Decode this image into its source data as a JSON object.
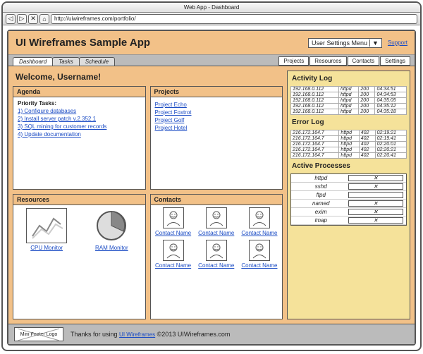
{
  "browser": {
    "title": "Web App - Dashboard",
    "url": "http://uiwireframes.com/portfolio/"
  },
  "header": {
    "title": "UI Wireframes Sample App",
    "user_menu": "User Settings Menu",
    "support": "Support"
  },
  "tabs": {
    "left": [
      "Dashboard",
      "Tasks",
      "Schedule"
    ],
    "right": [
      "Projects",
      "Resources",
      "Contacts",
      "Settings"
    ]
  },
  "welcome": "Welcome, Username!",
  "agenda": {
    "title": "Agenda",
    "subtitle": "Priority Tasks:",
    "items": [
      "1) Configure databases",
      "2) Install server patch v.2.352.1",
      "3) SQL mining for customer records",
      "4) Update documentation"
    ]
  },
  "projects": {
    "title": "Projects",
    "items": [
      "Project Echo",
      "Project Foxtrot",
      "Project Golf",
      "Project Hotel"
    ]
  },
  "resources": {
    "title": "Resources",
    "items": [
      "CPU Monitor",
      "RAM Monitor"
    ]
  },
  "contacts": {
    "title": "Contacts",
    "label": "Contact Name"
  },
  "sidebar": {
    "activity": {
      "title": "Activity Log",
      "rows": [
        [
          "192.168.0.112",
          "httpd",
          "200",
          "04:34:51"
        ],
        [
          "192.168.0.112",
          "httpd",
          "200",
          "04:34:53"
        ],
        [
          "192.168.0.112",
          "httpd",
          "200",
          "04:35:05"
        ],
        [
          "192.168.0.112",
          "httpd",
          "200",
          "04:35:12"
        ],
        [
          "192.168.0.112",
          "httpd",
          "200",
          "04:35:18"
        ]
      ]
    },
    "error": {
      "title": "Error Log",
      "rows": [
        [
          "216.172.164.7",
          "httpd",
          "402",
          "02:19:21"
        ],
        [
          "216.172.164.7",
          "httpd",
          "402",
          "02:19:41"
        ],
        [
          "216.172.164.7",
          "httpd",
          "402",
          "02:20:01"
        ],
        [
          "216.172.164.7",
          "httpd",
          "402",
          "02:20:21"
        ],
        [
          "216.172.164.7",
          "httpd",
          "402",
          "02:20:41"
        ]
      ]
    },
    "processes": {
      "title": "Active Processes",
      "items": [
        "httpd",
        "sshd",
        "ftpd",
        "named",
        "exim",
        "imap"
      ]
    }
  },
  "footer": {
    "logo": "Mini Footer Logo",
    "text_pre": "Thanks for using ",
    "link": "UI Wireframes",
    "text_post": " ©2013 UIWireframes.com"
  }
}
